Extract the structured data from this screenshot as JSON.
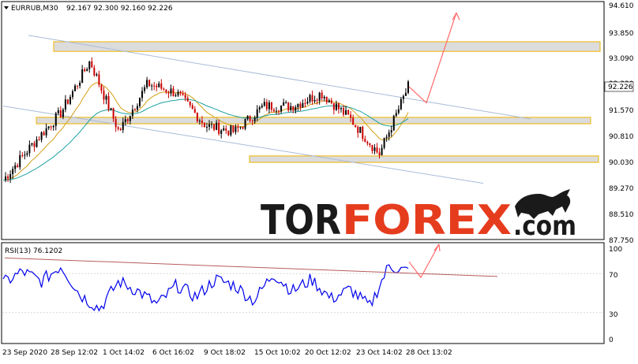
{
  "header": {
    "symbol": "EURRUB,M30",
    "ohlc": "92.167 92.300 92.160 92.226"
  },
  "price_axis": {
    "ticks": [
      "94.610",
      "93.850",
      "93.090",
      "92.330",
      "91.570",
      "90.810",
      "90.030",
      "89.270",
      "88.510",
      "87.750"
    ],
    "current_price": "92.226"
  },
  "rsi_panel": {
    "label": "RSI(13) 76.1202",
    "ticks": [
      "100",
      "70",
      "30",
      "0"
    ]
  },
  "time_axis": {
    "labels": [
      "23 Sep 2020",
      "28 Sep 12:02",
      "1 Oct 14:02",
      "6 Oct 16:02",
      "9 Oct 18:02",
      "15 Oct 10:02",
      "20 Oct 12:02",
      "23 Oct 14:02",
      "28 Oct 13:02"
    ]
  },
  "brand": {
    "part1": "TOR",
    "part2": "FOREX",
    "part3": ".com"
  },
  "colors": {
    "bull_candle": "#000000",
    "bear_candle": "#cc0000",
    "ma_fast": "#d4a017",
    "ma_slow": "#20a0a0",
    "rsi_line": "#0000ee",
    "forecast_arrow": "#ff6a6a",
    "zone_fill": "#dcdcdc",
    "zone_border": "#f0b400",
    "channel": "#a8bcd8",
    "rsi_trend": "#b85c5c",
    "brand_dark": "#1a1a1a",
    "brand_red": "#e63c1e"
  },
  "chart_data": {
    "type": "candlestick",
    "title": "EURRUB,M30",
    "ylim": [
      87.5,
      94.8
    ],
    "x": [
      "23 Sep 2020",
      "28 Sep 12:02",
      "1 Oct 14:02",
      "6 Oct 16:02",
      "9 Oct 18:02",
      "15 Oct 10:02",
      "20 Oct 12:02",
      "23 Oct 14:02",
      "28 Oct 13:02"
    ],
    "series": [
      {
        "values": [
          89.3,
          90.4,
          91.4,
          93.0,
          90.8,
          92.3,
          92.0,
          91.0,
          90.8,
          91.6,
          91.6,
          92.0,
          91.2,
          90.1,
          92.2
        ]
      }
    ],
    "support_resistance_zones": [
      [
        93.3,
        93.6
      ],
      [
        91.05,
        91.25
      ],
      [
        89.85,
        90.05
      ]
    ],
    "rsi": {
      "ylim": [
        0,
        100
      ],
      "levels": [
        70,
        30
      ],
      "last": 76.1202,
      "values": [
        60,
        72,
        62,
        78,
        48,
        34,
        62,
        52,
        38,
        58,
        46,
        64,
        58,
        42,
        70,
        52,
        64,
        44,
        54,
        36,
        78,
        72
      ]
    },
    "forecast": [
      92.2,
      91.7,
      94.5
    ]
  }
}
